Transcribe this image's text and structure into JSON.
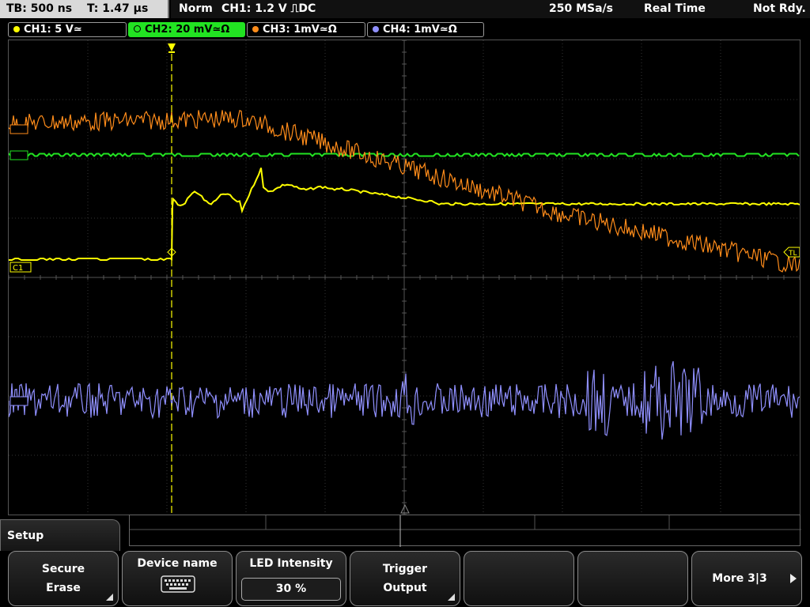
{
  "timebase": {
    "tb": "TB: 500 ns",
    "t": "T: 1.47 µs"
  },
  "status": {
    "mode": "Norm",
    "trigger": "CH1: 1.2 V ⎍DC",
    "sample_rate": "250 MSa/s",
    "acq": "Real Time",
    "state": "Not Rdy."
  },
  "channels": [
    {
      "label": "CH1: 5 V≃",
      "color": "#ffff00",
      "active": false
    },
    {
      "label": "CH2: 20 mV≃Ω",
      "color": "#22e322",
      "active": true
    },
    {
      "label": "CH3: 1mV≃Ω",
      "color": "#ff8c1a",
      "active": false
    },
    {
      "label": "CH4: 1mV≃Ω",
      "color": "#9090ff",
      "active": false
    }
  ],
  "markers": {
    "ch1": "C1",
    "trigger_level": "TL"
  },
  "menu": {
    "title": "Setup",
    "softkeys": [
      {
        "l1": "Secure",
        "l2": "Erase"
      },
      {
        "l1": "Device name",
        "icon": "keyboard-icon"
      },
      {
        "l1": "LED Intensity",
        "value": "30 %"
      },
      {
        "l1": "Trigger",
        "l2": "Output"
      },
      {
        "l1": ""
      },
      {
        "l1": ""
      },
      {
        "l1": "More 3|3"
      }
    ]
  }
}
